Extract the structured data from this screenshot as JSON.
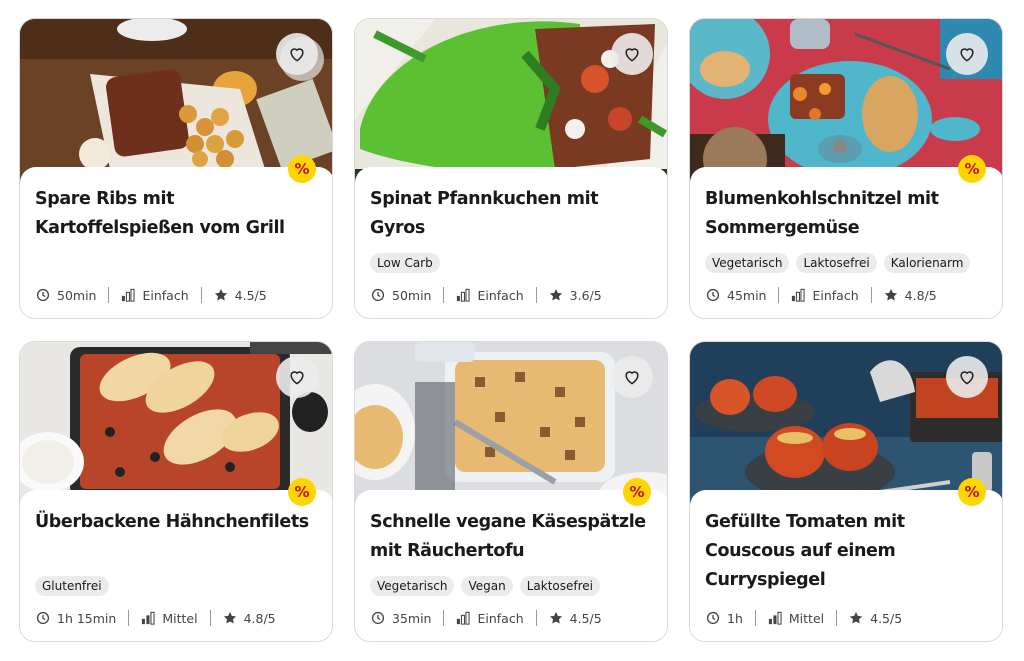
{
  "colors": {
    "promo_badge": "#ffd500",
    "promo_text": "#c8102e",
    "tag_bg": "#ebebeb"
  },
  "recipes": [
    {
      "title": "Spare Ribs mit Kartoffelspießen vom Grill",
      "tags": [],
      "time": "50min",
      "difficulty": "Einfach",
      "rating": "4.5/5",
      "promo": "%",
      "favorite_icon": "heart-outline-icon"
    },
    {
      "title": "Spinat Pfannkuchen mit Gyros",
      "tags": [
        "Low Carb"
      ],
      "time": "50min",
      "difficulty": "Einfach",
      "rating": "3.6/5",
      "promo": "",
      "favorite_icon": "heart-outline-icon"
    },
    {
      "title": "Blumenkohlschnitzel mit Sommergemüse",
      "tags": [
        "Vegetarisch",
        "Laktosefrei",
        "Kalorienarm"
      ],
      "time": "45min",
      "difficulty": "Einfach",
      "rating": "4.8/5",
      "promo": "%",
      "favorite_icon": "heart-outline-icon"
    },
    {
      "title": "Überbackene Hähnchenfilets",
      "tags": [
        "Glutenfrei"
      ],
      "time": "1h 15min",
      "difficulty": "Mittel",
      "rating": "4.8/5",
      "promo": "%",
      "favorite_icon": "heart-outline-icon"
    },
    {
      "title": "Schnelle vegane Käsespätzle mit Räuchertofu",
      "tags": [
        "Vegetarisch",
        "Vegan",
        "Laktosefrei"
      ],
      "time": "35min",
      "difficulty": "Einfach",
      "rating": "4.5/5",
      "promo": "%",
      "favorite_icon": "heart-outline-icon"
    },
    {
      "title": "Gefüllte Tomaten mit Couscous auf einem Curryspiegel",
      "tags": [],
      "time": "1h",
      "difficulty": "Mittel",
      "rating": "4.5/5",
      "promo": "%",
      "favorite_icon": "heart-outline-icon"
    }
  ]
}
